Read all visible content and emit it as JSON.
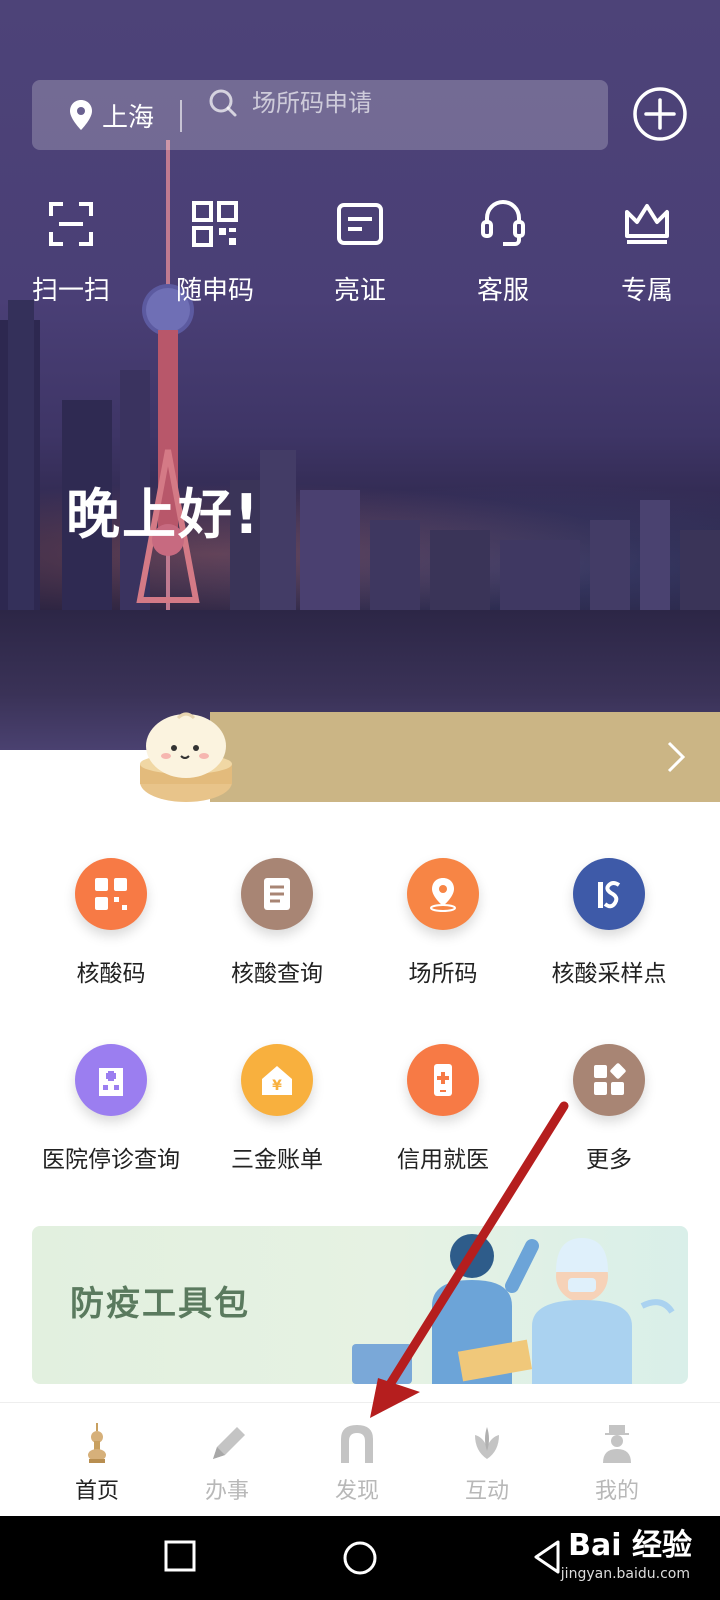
{
  "header": {
    "location": "上海",
    "search_placeholder": "场所码申请"
  },
  "quick_actions": [
    {
      "label": "扫一扫",
      "icon": "scan-icon"
    },
    {
      "label": "随申码",
      "icon": "qrcode-icon"
    },
    {
      "label": "亮证",
      "icon": "id-card-icon"
    },
    {
      "label": "客服",
      "icon": "headset-icon"
    },
    {
      "label": "专属",
      "icon": "crown-icon"
    }
  ],
  "greeting": "晚上好!",
  "services": [
    {
      "label": "核酸码",
      "icon": "qrcode-icon",
      "color": "#f77a45"
    },
    {
      "label": "核酸查询",
      "icon": "document-icon",
      "color": "#a88574"
    },
    {
      "label": "场所码",
      "icon": "location-pin-icon",
      "color": "#f78545"
    },
    {
      "label": "核酸采样点",
      "icon": "sampling-logo-icon",
      "color": "#3e5aa8"
    },
    {
      "label": "医院停诊查询",
      "icon": "hospital-icon",
      "color": "#9b7ef0"
    },
    {
      "label": "三金账单",
      "icon": "house-yuan-icon",
      "color": "#f8b03e"
    },
    {
      "label": "信用就医",
      "icon": "phone-medical-icon",
      "color": "#f77a45"
    },
    {
      "label": "更多",
      "icon": "grid-more-icon",
      "color": "#a88574"
    }
  ],
  "card": {
    "title": "防疫工具包"
  },
  "tabs": [
    {
      "label": "首页",
      "icon": "pagoda-icon",
      "active": true
    },
    {
      "label": "办事",
      "icon": "pen-icon",
      "active": false
    },
    {
      "label": "发现",
      "icon": "arch-icon",
      "active": false
    },
    {
      "label": "互动",
      "icon": "magnolia-icon",
      "active": false
    },
    {
      "label": "我的",
      "icon": "person-icon",
      "active": false
    }
  ],
  "watermark": {
    "brand": "Bai 经验",
    "url": "jingyan.baidu.com"
  }
}
